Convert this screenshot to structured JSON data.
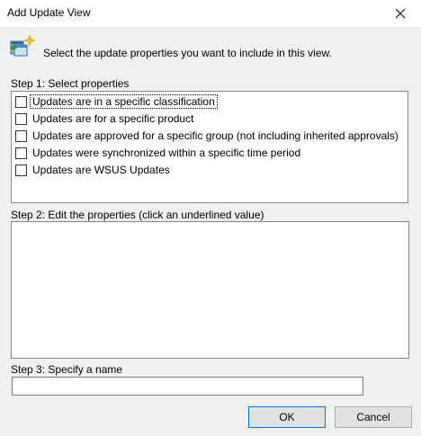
{
  "window": {
    "title": "Add Update View",
    "close_icon": "close-icon"
  },
  "header": {
    "icon": "update-view-wizard-icon",
    "instruction": "Select the update properties you want to include in this view."
  },
  "step1": {
    "label": "Step 1: Select properties",
    "properties": [
      {
        "label": "Updates are in a specific classification",
        "checked": false,
        "focused": true
      },
      {
        "label": "Updates are for a specific product",
        "checked": false,
        "focused": false
      },
      {
        "label": "Updates are approved for a specific group (not including inherited approvals)",
        "checked": false,
        "focused": false
      },
      {
        "label": "Updates were synchronized within a specific time period",
        "checked": false,
        "focused": false
      },
      {
        "label": "Updates are WSUS Updates",
        "checked": false,
        "focused": false
      }
    ]
  },
  "step2": {
    "label": "Step 2: Edit the properties (click an underlined value)",
    "content": ""
  },
  "step3": {
    "label": "Step 3: Specify a name",
    "name_value": "",
    "name_placeholder": ""
  },
  "buttons": {
    "ok_label": "OK",
    "cancel_label": "Cancel"
  },
  "colors": {
    "background": "#f0f0f0",
    "titlebar": "#ffffff",
    "default_button_border": "#0078d7",
    "field_border": "#828790"
  }
}
